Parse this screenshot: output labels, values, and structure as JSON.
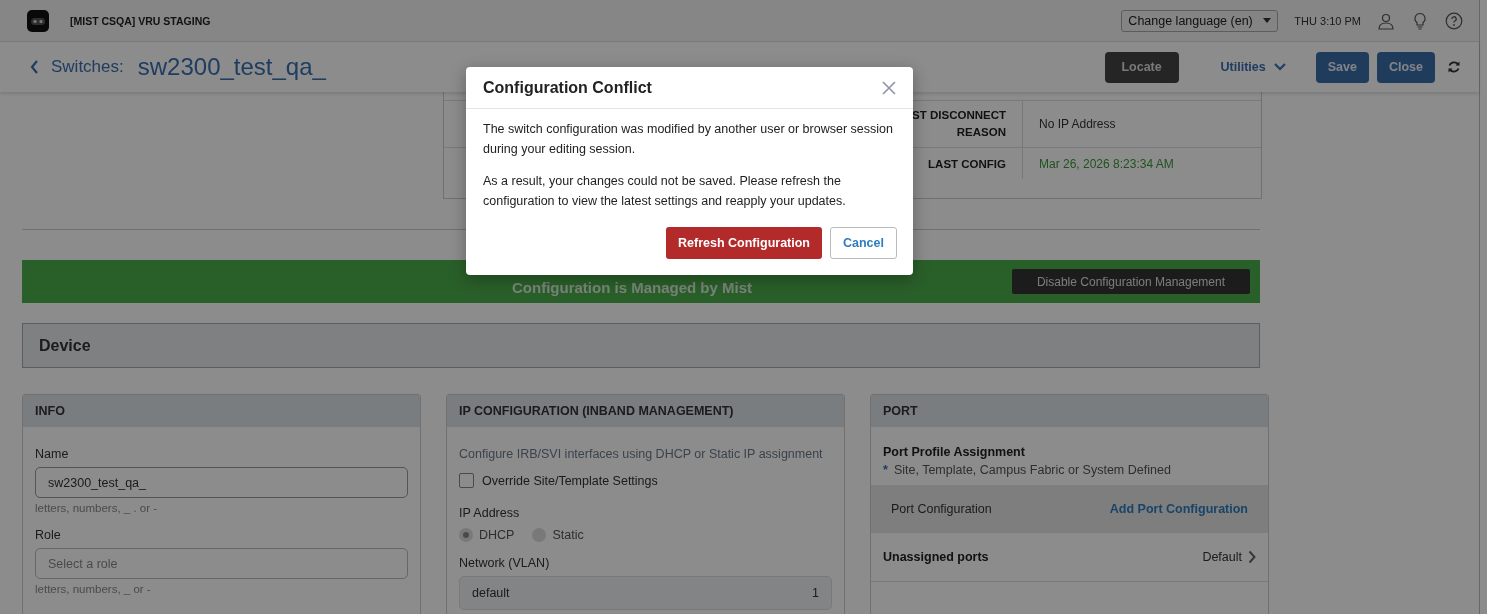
{
  "header": {
    "org": "[MIST CSQA] VRU STAGING",
    "language_select": "Change language (en)",
    "time": "THU 3:10 PM"
  },
  "page": {
    "breadcrumb": "Switches:",
    "title": "sw2300_test_qa_",
    "actions": [
      {
        "label": "Locate",
        "kind": "dark"
      },
      {
        "label": "Utilities",
        "kind": "dropdown"
      },
      {
        "label": "Save",
        "kind": "primary"
      },
      {
        "label": "Close",
        "kind": "primary"
      }
    ]
  },
  "status_table": [
    {
      "label": "ST DISCONNECT REASON",
      "value": "No IP Address",
      "kind": "plain"
    },
    {
      "label": "LAST CONFIG",
      "value": "Mar 26, 2026 8:23:34 AM",
      "kind": "success"
    }
  ],
  "management_banner": {
    "text": "Configuration is Managed by Mist",
    "button": "Disable Configuration Management"
  },
  "device_section": {
    "title": "Device"
  },
  "info": {
    "title": "INFO",
    "fields": [
      {
        "label": "Name",
        "value": "sw2300_test_qa_",
        "hint": "letters, numbers, _ . or -"
      },
      {
        "label": "Role",
        "placeholder": "Select a role",
        "hint": "letters, numbers, _ or -"
      }
    ]
  },
  "ip_config": {
    "title": "IP CONFIGURATION (INBAND MANAGEMENT)",
    "description": "Configure IRB/SVI interfaces using DHCP or Static IP assignment",
    "override": {
      "label": "Override Site/Template Settings",
      "checked": false
    },
    "ip_address": {
      "label": "IP Address",
      "options": [
        {
          "label": "DHCP",
          "selected": true
        },
        {
          "label": "Static",
          "selected": false
        }
      ]
    },
    "network": {
      "label": "Network (VLAN)",
      "value": "default",
      "vlan": "1"
    }
  },
  "port": {
    "title": "PORT",
    "profile_title": "Port Profile Assignment",
    "profile_marker": "*",
    "profile_note": "Site, Template, Campus Fabric or System Defined",
    "port_configuration": {
      "label": "Port Configuration",
      "action": "Add Port Configuration"
    },
    "unassigned": {
      "label": "Unassigned ports",
      "value": "Default"
    }
  },
  "dialog": {
    "title": "Configuration Conflict",
    "paragraphs": [
      "The switch configuration was modified by another user or browser session during your editing session.",
      "As a result, your changes could not be saved. Please refresh the configuration to view the latest settings and reapply your updates."
    ],
    "buttons": [
      {
        "label": "Refresh Configuration",
        "kind": "danger"
      },
      {
        "label": "Cancel",
        "kind": "secondary"
      }
    ]
  }
}
